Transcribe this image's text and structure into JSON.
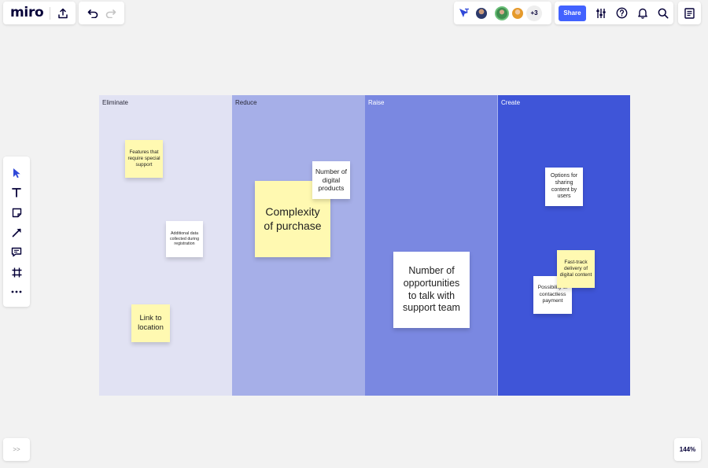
{
  "app": {
    "logo": "miro"
  },
  "collab": {
    "extra_users": "+3"
  },
  "toolbar": {
    "share_label": "Share"
  },
  "board": {
    "columns": [
      {
        "title": "Eliminate"
      },
      {
        "title": "Reduce"
      },
      {
        "title": "Raise"
      },
      {
        "title": "Create"
      }
    ],
    "notes": {
      "features": "Features that require special support",
      "additional": "Additional data collected during registration",
      "link": "Link to location",
      "complexity": "Complexity of purchase",
      "digital": "Number of digital products",
      "opportunities": "Number of opportunities to talk with support team",
      "options": "Options for sharing content by users",
      "fasttrack": "Fast-track delivery of digital content",
      "possibility": "Possibility of contactless payment"
    }
  },
  "footer": {
    "expand_label": ">>",
    "zoom": "144%"
  },
  "colors": {
    "accent": "#4262ff",
    "sticky_yellow": "#fff9b1"
  }
}
